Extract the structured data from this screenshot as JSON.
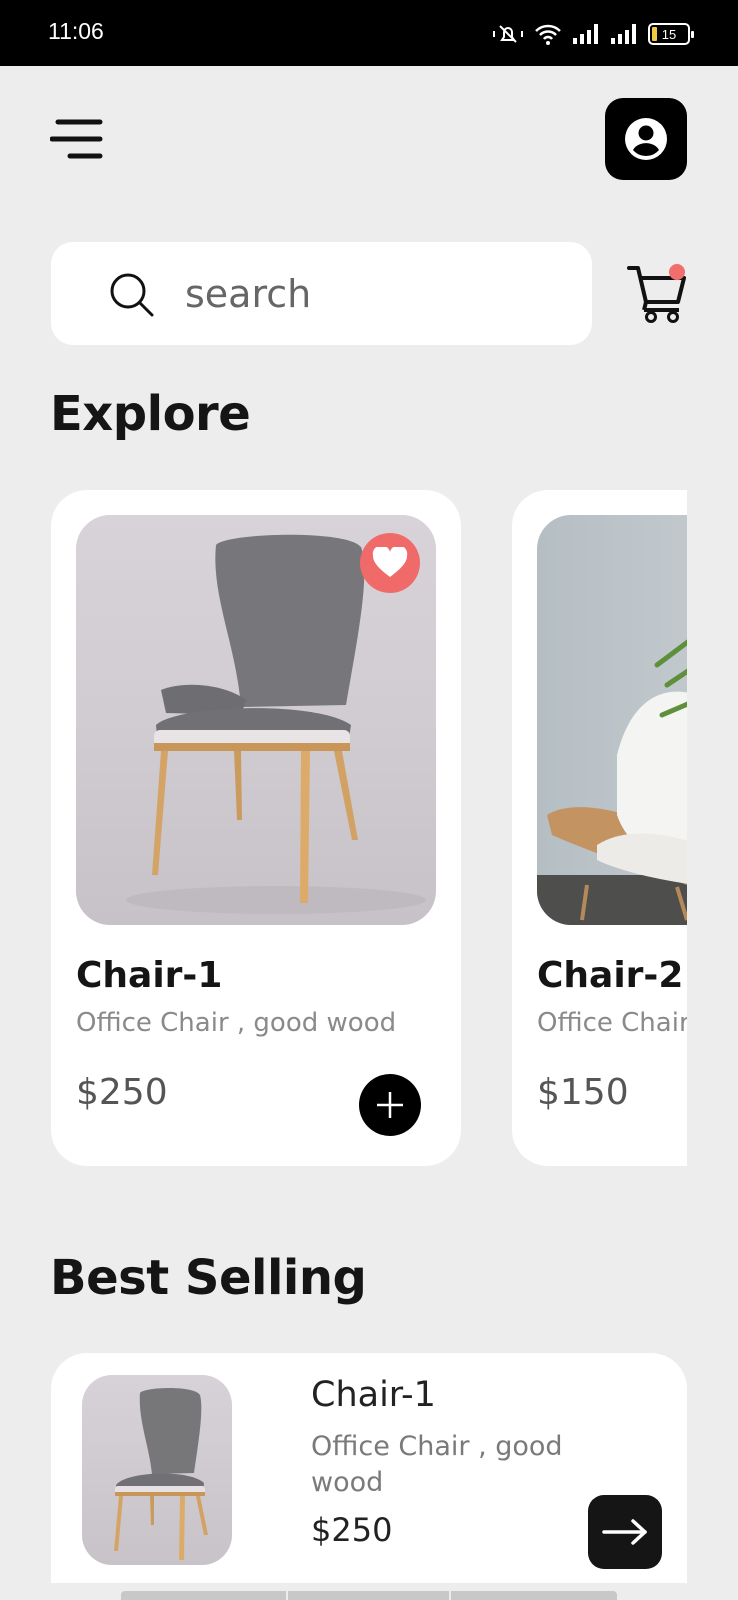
{
  "status_bar": {
    "time": "11:06",
    "battery": "15"
  },
  "search": {
    "placeholder": "search"
  },
  "sections": {
    "explore": "Explore",
    "best_selling": "Best Selling"
  },
  "explore": [
    {
      "name": "Chair-1",
      "description": "Office Chair , good wood",
      "price": "$250",
      "favorite": true
    },
    {
      "name": "Chair-2",
      "description": "Office Chair , good wood",
      "price": "$150",
      "favorite": false
    }
  ],
  "best_selling": [
    {
      "name": "Chair-1",
      "description": "Office Chair , good wood",
      "price": "$250"
    }
  ],
  "colors": {
    "accent": "#f06a6a",
    "dark": "#000000",
    "background": "#ededed"
  },
  "icons": [
    "menu-icon",
    "profile-icon",
    "search-icon",
    "cart-icon",
    "heart-icon",
    "plus-icon",
    "arrow-right-icon"
  ]
}
